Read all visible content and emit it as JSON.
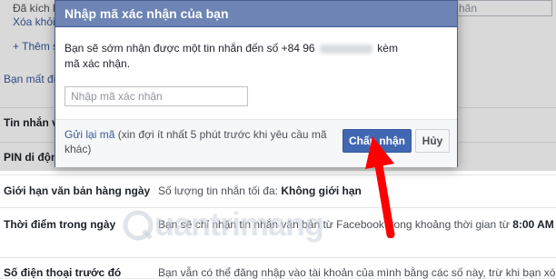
{
  "background": {
    "top_note_line1": "Đã kích h",
    "top_note_line2": "Xóa khỏi",
    "top_input_text": "hãn",
    "add_phone": "+ Thêm s",
    "lost_phone": "Bạn mất đi",
    "rows": [
      {
        "label": "Tin nhắn v",
        "value": ""
      },
      {
        "label": "PIN di động",
        "value": ""
      },
      {
        "label": "Giới hạn văn bản hàng ngày",
        "value_prefix": "Số lượng tin nhắn tối đa: ",
        "value_bold": "Không giới hạn"
      },
      {
        "label": "Thời điểm trong ngày",
        "value_prefix": "Bạn sẽ chỉ nhận tin nhắn văn bản từ Facebook trong khoảng thời gian từ ",
        "value_bold": "8:00 AM"
      },
      {
        "label": "Số điện thoại trước đó",
        "value_prefix": "Bạn vẫn có thể đăng nhập vào tài khoản của mình bằng các số này, trừ khi bạn xóa",
        "value_bold": ""
      }
    ]
  },
  "dialog": {
    "title": "Nhập mã xác nhận của bạn",
    "message_before": "Bạn sẽ sớm nhận được một tin nhắn đến số +84 96",
    "message_after": "kèm mã xác nhận.",
    "input_placeholder": "Nhập mã xác nhận",
    "input_value": "",
    "resend_link": "Gửi lại mã",
    "resend_note": " (xin đợi ít nhất 5 phút trước khi yêu cầu mã khác)",
    "confirm_label": "Chấp nhận",
    "cancel_label": "Hủy"
  },
  "watermark": {
    "text": "uantrimang",
    "icon": "quantrimang-logo-icon"
  },
  "colors": {
    "header": "#6d84b4",
    "primary_button": "#4267b2",
    "link": "#365899",
    "arrow": "#ff0000"
  }
}
